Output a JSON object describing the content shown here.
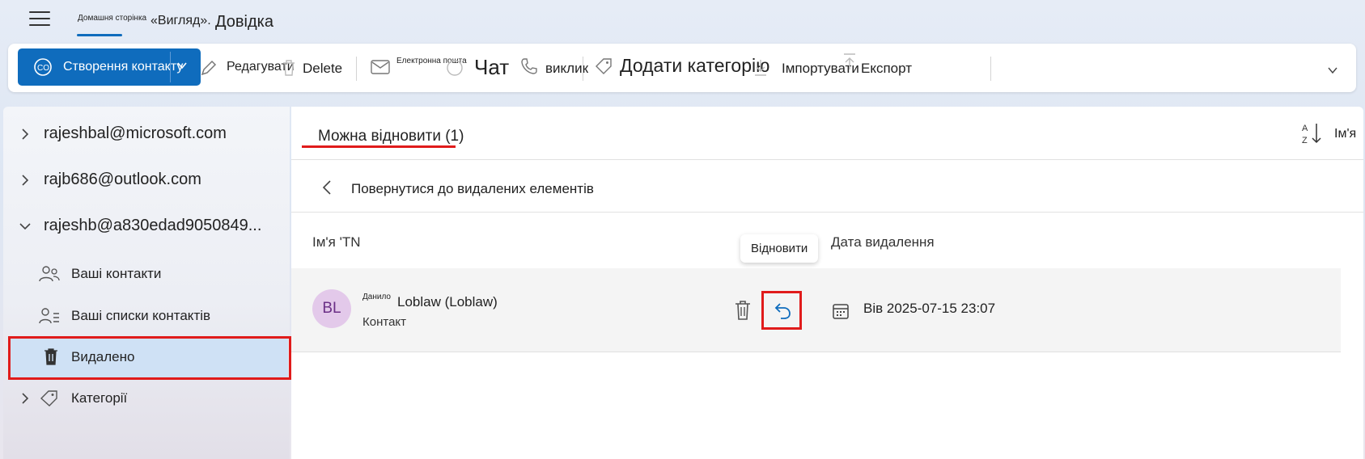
{
  "tabs": {
    "home": "Домашня сторінка",
    "view": "«Вигляд».",
    "help": "Довідка"
  },
  "ribbon": {
    "new_contact": "Створення контакту",
    "edit": "Редагувати",
    "delete": "Delete",
    "email": "Електронна пошта",
    "chat": "Чат",
    "call": "виклик",
    "add_category": "Додати категорію",
    "import": "Імпортувати",
    "export": "Експорт"
  },
  "sidebar": {
    "accounts": [
      {
        "label": "rajeshbal@microsoft.com",
        "expanded": false
      },
      {
        "label": "rajb686@outlook.com",
        "expanded": false
      },
      {
        "label": "rajeshb@a830edad9050849...",
        "expanded": true
      }
    ],
    "items": [
      {
        "label": "Ваші контакти",
        "icon": "people-icon"
      },
      {
        "label": "Ваші списки контактів",
        "icon": "contact-list-icon"
      },
      {
        "label": "Видалено",
        "icon": "trash-icon",
        "selected": true
      },
      {
        "label": "Категорії",
        "icon": "tag-icon"
      }
    ]
  },
  "main": {
    "title": "Можна відновити (1)",
    "sort_label": "Ім'я",
    "back_label": "Повернутися до видалених елементів",
    "columns": {
      "name": "Ім'я 'TN",
      "deleted_date": "Дата видалення"
    },
    "rows": [
      {
        "initials": "BL",
        "prefix": "Данило",
        "name": "Loblaw (Loblaw)",
        "type": "Контакт",
        "deleted": "Вів 2025-07-15 23:07"
      }
    ],
    "tooltip": "Відновити"
  },
  "colors": {
    "accent": "#0f6cbd",
    "highlight": "#e01b1b",
    "selected": "#cfe1f5",
    "avatar_bg": "#e3c9ea"
  }
}
